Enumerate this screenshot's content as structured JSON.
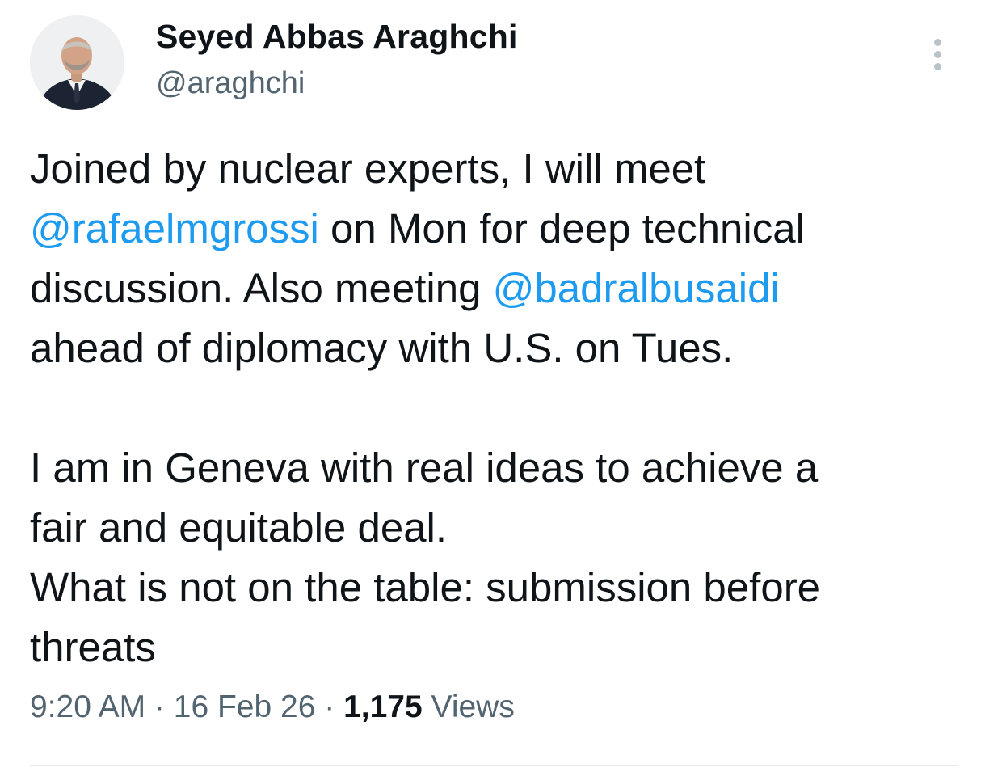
{
  "author": {
    "display_name": "Seyed Abbas Araghchi",
    "handle": "@araghchi"
  },
  "menu": {
    "icon": "more-vertical-icon"
  },
  "tweet": {
    "lines": [
      {
        "before": "Joined by nuclear experts, I will meet"
      },
      {
        "mention": "@rafaelmgrossi",
        "after": " on Mon for deep technical"
      },
      {
        "before": "discussion. Also meeting ",
        "mention": "@badralbusaidi"
      },
      {
        "before": "ahead of diplomacy with U.S. on Tues."
      },
      {
        "before": "I am in Geneva with real ideas to achieve a"
      },
      {
        "before": "fair and equitable deal."
      },
      {
        "before": "What is not on the table: submission before"
      },
      {
        "before": "threats"
      }
    ]
  },
  "meta": {
    "time": "9:20 AM",
    "separator": " · ",
    "date": "16 Feb 26",
    "views_count": "1,175",
    "views_label": " Views"
  },
  "colors": {
    "text": "#0f1419",
    "secondary": "#536471",
    "link": "#1d9bf0"
  }
}
